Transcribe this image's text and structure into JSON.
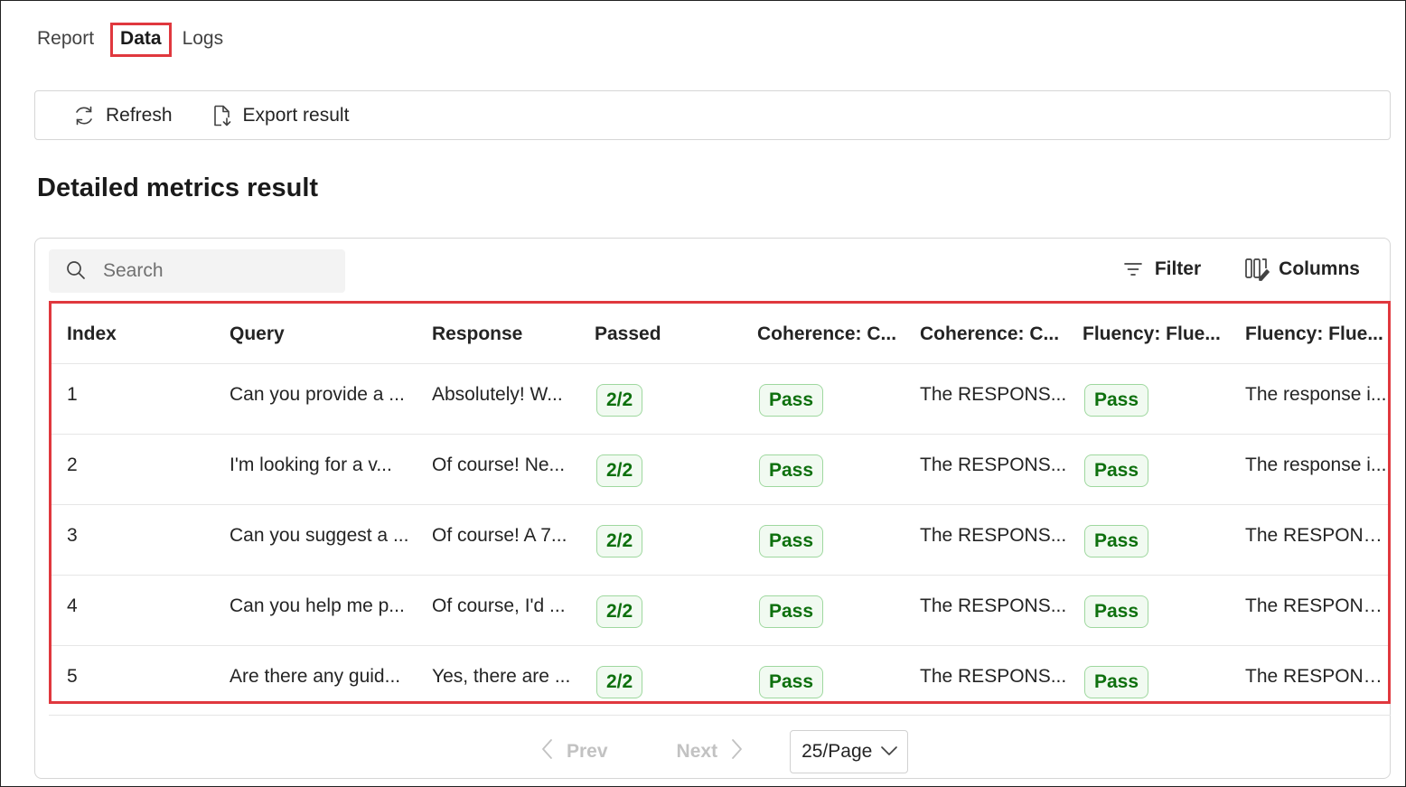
{
  "tabs": [
    {
      "label": "Report"
    },
    {
      "label": "Data"
    },
    {
      "label": "Logs"
    }
  ],
  "toolbar": {
    "refresh_label": "Refresh",
    "export_label": "Export result"
  },
  "section_title": "Detailed metrics result",
  "search": {
    "placeholder": "Search",
    "value": ""
  },
  "filter_label": "Filter",
  "columns_label": "Columns",
  "table": {
    "headers": [
      "Index",
      "Query",
      "Response",
      "Passed",
      "Coherence: C...",
      "Coherence: C...",
      "Fluency: Flue...",
      "Fluency: Flue..."
    ],
    "rows": [
      [
        "1",
        "Can you provide a ...",
        "Absolutely! W...",
        "2/2",
        "Pass",
        "The RESPONS...",
        "Pass",
        "The response i..."
      ],
      [
        "2",
        "I'm looking for a v...",
        "Of course! Ne...",
        "2/2",
        "Pass",
        "The RESPONS...",
        "Pass",
        "The response i..."
      ],
      [
        "3",
        "Can you suggest a ...",
        "Of course! A 7...",
        "2/2",
        "Pass",
        "The RESPONS...",
        "Pass",
        "The RESPONS..."
      ],
      [
        "4",
        "Can you help me p...",
        "Of course, I'd ...",
        "2/2",
        "Pass",
        "The RESPONS...",
        "Pass",
        "The RESPONS..."
      ],
      [
        "5",
        "Are there any guid...",
        "Yes, there are ...",
        "2/2",
        "Pass",
        "The RESPONS...",
        "Pass",
        "The RESPONS..."
      ]
    ]
  },
  "pagination": {
    "prev_label": "Prev",
    "next_label": "Next",
    "page_size": "25/Page"
  },
  "colors": {
    "highlight": "#e0383e",
    "pass_text": "#0e700e",
    "pass_bg": "#f1faf1",
    "pass_border": "#9fd89f"
  },
  "icons": {
    "refresh": "refresh-icon",
    "export": "export-document-icon",
    "search": "search-icon",
    "filter": "filter-icon",
    "columns": "columns-icon",
    "prev": "chevron-left-icon",
    "next": "chevron-right-icon",
    "dropdown": "chevron-down-icon"
  }
}
